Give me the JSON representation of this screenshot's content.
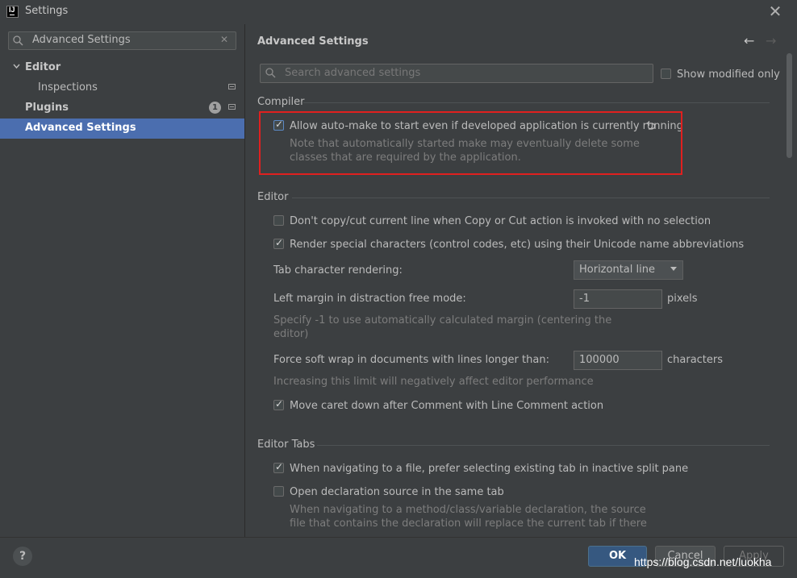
{
  "window": {
    "title": "Settings"
  },
  "sidebar": {
    "search_value": "Advanced Settings",
    "items": [
      {
        "label": "Editor"
      },
      {
        "label": "Inspections"
      },
      {
        "label": "Plugins",
        "badge": "1"
      },
      {
        "label": "Advanced Settings"
      }
    ]
  },
  "main": {
    "title": "Advanced Settings",
    "search_placeholder": "Search advanced settings",
    "show_modified_label": "Show modified only",
    "compiler": {
      "header": "Compiler",
      "auto_make_label": "Allow auto-make to start even if developed application is currently running",
      "auto_make_note_1": "Note that automatically started make may eventually delete some",
      "auto_make_note_2": "classes that are required by the application."
    },
    "editor": {
      "header": "Editor",
      "copy_cut_label": "Don't copy/cut current line when Copy or Cut action is invoked with no selection",
      "render_special_label": "Render special characters (control codes, etc) using their Unicode name abbreviations",
      "tab_rendering_label": "Tab character rendering:",
      "tab_rendering_value": "Horizontal line",
      "left_margin_label": "Left margin in distraction free mode:",
      "left_margin_value": "-1",
      "left_margin_unit": "pixels",
      "left_margin_note_1": "Specify -1 to use automatically calculated margin (centering the",
      "left_margin_note_2": "editor)",
      "soft_wrap_label": "Force soft wrap in documents with lines longer than:",
      "soft_wrap_value": "100000",
      "soft_wrap_unit": "characters",
      "soft_wrap_note": "Increasing this limit will negatively affect editor performance",
      "move_caret_label": "Move caret down after Comment with Line Comment action"
    },
    "editor_tabs": {
      "header": "Editor Tabs",
      "prefer_existing_label": "When navigating to a file, prefer selecting existing tab in inactive split pane",
      "open_decl_label": "Open declaration source in the same tab",
      "open_decl_note_1": "When navigating to a method/class/variable declaration, the source",
      "open_decl_note_2": "file that contains the declaration will replace the current tab if there"
    }
  },
  "buttons": {
    "ok": "OK",
    "cancel": "Cancel",
    "apply": "Apply",
    "help": "?"
  },
  "watermark": "https://blog.csdn.net/luokha"
}
